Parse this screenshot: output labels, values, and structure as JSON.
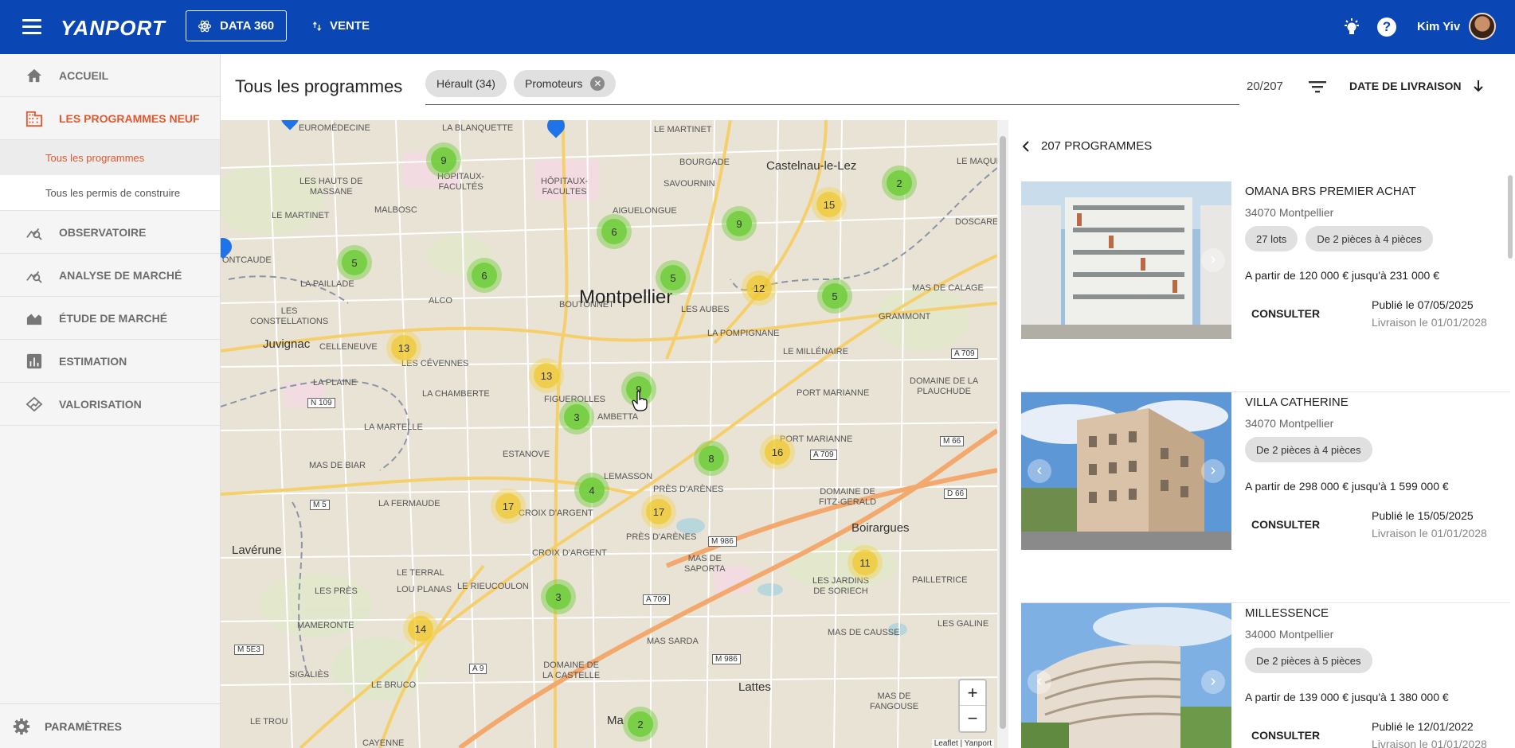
{
  "topbar": {
    "logo": "YANPORT",
    "data360_label": "DATA 360",
    "vente_label": "VENTE",
    "user_name": "Kim Yiv",
    "help_glyph": "?"
  },
  "sidebar": {
    "items": [
      {
        "label": "ACCUEIL",
        "icon": "home-icon"
      },
      {
        "label": "LES PROGRAMMES NEUF",
        "icon": "building-icon"
      },
      {
        "label": "OBSERVATOIRE",
        "icon": "chart-search-icon"
      },
      {
        "label": "ANALYSE DE MARCHÉ",
        "icon": "chart-search-icon"
      },
      {
        "label": "ÉTUDE DE MARCHÉ",
        "icon": "area-chart-icon"
      },
      {
        "label": "ESTIMATION",
        "icon": "bar-chart-icon"
      },
      {
        "label": "VALORISATION",
        "icon": "house-value-icon"
      }
    ],
    "sub_items": [
      "Tous les programmes",
      "Tous les permis de construire"
    ],
    "params_label": "PARAMÈTRES"
  },
  "header": {
    "title": "Tous les programmes",
    "chips": [
      {
        "label": "Hérault (34)"
      },
      {
        "label": "Promoteurs"
      }
    ],
    "chip_close": "✕",
    "count": "20/207",
    "sort_label": "DATE DE LIVRAISON"
  },
  "map": {
    "places": {
      "montpellier": "Montpellier",
      "castelnau": "Castelnau-le-Lez",
      "juvignac": "Juvignac",
      "laverune": "Lavérune",
      "lattes": "Lattes",
      "boirargues": "Boirargues",
      "euromedecine": "EUROMÉDECINE",
      "blanquette": "LA BLANQUETTE",
      "lemartinet": "LE MARTINET",
      "bourgade": "BOURGADE",
      "hautsmassane": "LES HAUTS DE\nMASSANE",
      "hopitaux": "HÔPITAUX-\nFACULTÉS",
      "hopitaux2": "HÔPITAUX-\nFACULTES",
      "savournin": "SAVOURNIN",
      "aiguelongue": "AIGUELONGUE",
      "lemaquet": "LE MAQUET",
      "lemartinet2": "LE MARTINET",
      "malbosc": "MALBOSC",
      "doscare": "DOSCARE",
      "montcaude": "ONTCAUDE",
      "lapaillade": "LA PAILLADE",
      "alco": "ALCO",
      "boutonnet": "BOUTONNET",
      "lesaubes": "LES AUBES",
      "masdecalage": "MAS DE CALAGE",
      "grammont": "GRAMMONT",
      "constellations": "LES\nCONSTELLATIONS",
      "lapompignane": "LA POMPIGNANE",
      "celleneuve": "CELLENEUVE",
      "cevennes": "LES CÉVENNES",
      "lemillenaire": "LE MILLÉNAIRE",
      "laplaine": "LA PLAINE",
      "lachamberte": "LA CHAMBERTE",
      "figuerolles": "FIGUEROLLES",
      "gambetta": "AMBETTA",
      "portmarianne": "PORT MARIANNE",
      "domaine": "DOMAINE DE LA\nPLAUCHUDE",
      "lamartelle": "LA MARTELLE",
      "estanove": "ESTANOVE",
      "portmarianne2": "PORT MARIANNE",
      "masdebiar": "MAS DE BIAR",
      "lemasson": "LEMASSON",
      "presdarenes": "PRÈS D'ARÈNES",
      "fitzgerald": "DOMAINE DE\nFITZ-GERALD",
      "lafermaude": "LA FERMAUDE",
      "croixargent": "CROIX D'ARGENT",
      "presdarenes2": "PRÈS D'ARÈNES",
      "croixargent2": "CROIX D'ARGENT",
      "masdesaporta": "MAS DE\nSAPORTA",
      "leterral": "LE TERRAL",
      "louplanas": "LOU PLANAS",
      "lesjardins": "LES JARDINS\nDE SORIECH",
      "pailletrice": "PAILLETRICE",
      "lespres": "LES PRÈS",
      "lerieucoulon": "LE RIEUCOULON",
      "mameronte": "MAMERONTE",
      "massarda": "MAS SARDA",
      "masdecausse": "MAS DE CAUSSE",
      "lesgaline": "LES GALINE",
      "sigaliès": "SIGALIÈS",
      "domainecastelle": "DOMAINE DE\nLA CASTELLE",
      "lebruco": "LE BRUCO",
      "masdefangouse": "MAS DE\nFANGOUSE",
      "letrou": "LE TROU",
      "cayenne": "CAYENNE",
      "mau": "Ma"
    },
    "roads": [
      "N 109",
      "M 5",
      "M 5E3",
      "A 709",
      "A 709",
      "M 66",
      "D 66",
      "M 986",
      "M 986",
      "A 709",
      "A 9"
    ],
    "clusters": [
      {
        "n": "9",
        "color": "green"
      },
      {
        "n": "2",
        "color": "green"
      },
      {
        "n": "15",
        "color": "yellow"
      },
      {
        "n": "6",
        "color": "green"
      },
      {
        "n": "9",
        "color": "green"
      },
      {
        "n": "5",
        "color": "green"
      },
      {
        "n": "6",
        "color": "green"
      },
      {
        "n": "5",
        "color": "green"
      },
      {
        "n": "12",
        "color": "yellow"
      },
      {
        "n": "5",
        "color": "green"
      },
      {
        "n": "13",
        "color": "yellow"
      },
      {
        "n": "13",
        "color": "yellow"
      },
      {
        "n": "9",
        "color": "green"
      },
      {
        "n": "3",
        "color": "green"
      },
      {
        "n": "8",
        "color": "green"
      },
      {
        "n": "16",
        "color": "yellow"
      },
      {
        "n": "4",
        "color": "green"
      },
      {
        "n": "17",
        "color": "yellow"
      },
      {
        "n": "17",
        "color": "yellow"
      },
      {
        "n": "11",
        "color": "yellow"
      },
      {
        "n": "3",
        "color": "green"
      },
      {
        "n": "14",
        "color": "yellow"
      },
      {
        "n": "2",
        "color": "green"
      }
    ],
    "zoom_in": "+",
    "zoom_out": "−",
    "attribution": "Leaflet | Yanport"
  },
  "list": {
    "header": "207 PROGRAMMES",
    "consult_label": "CONSULTER",
    "cards": [
      {
        "name": "OMANA BRS PREMIER ACHAT",
        "city": "34070 Montpellier",
        "tags": [
          "27 lots",
          "De 2 pièces à 4 pièces"
        ],
        "price": "A partir de 120 000 € jusqu'à 231 000 €",
        "published": "Publié le 07/05/2025",
        "delivery": "Livraison le 01/01/2028"
      },
      {
        "name": "VILLA CATHERINE",
        "city": "34070 Montpellier",
        "tags": [
          "De 2 pièces à 4 pièces"
        ],
        "price": "A partir de 298 000 € jusqu'à 1 599 000 €",
        "published": "Publié le 15/05/2025",
        "delivery": "Livraison le 01/01/2028"
      },
      {
        "name": "MILLESSENCE",
        "city": "34000 Montpellier",
        "tags": [
          "De 2 pièces à 5 pièces"
        ],
        "price": "A partir de 139 000 € jusqu'à 1 380 000 €",
        "published": "Publié le 12/01/2022",
        "delivery": "Livraison le 01/01/2028"
      }
    ]
  },
  "colors": {
    "brand_blue": "#0a47b5",
    "active_orange": "#e4572e",
    "cluster_green": "#6ecc39",
    "cluster_yellow": "#f0c20c"
  }
}
